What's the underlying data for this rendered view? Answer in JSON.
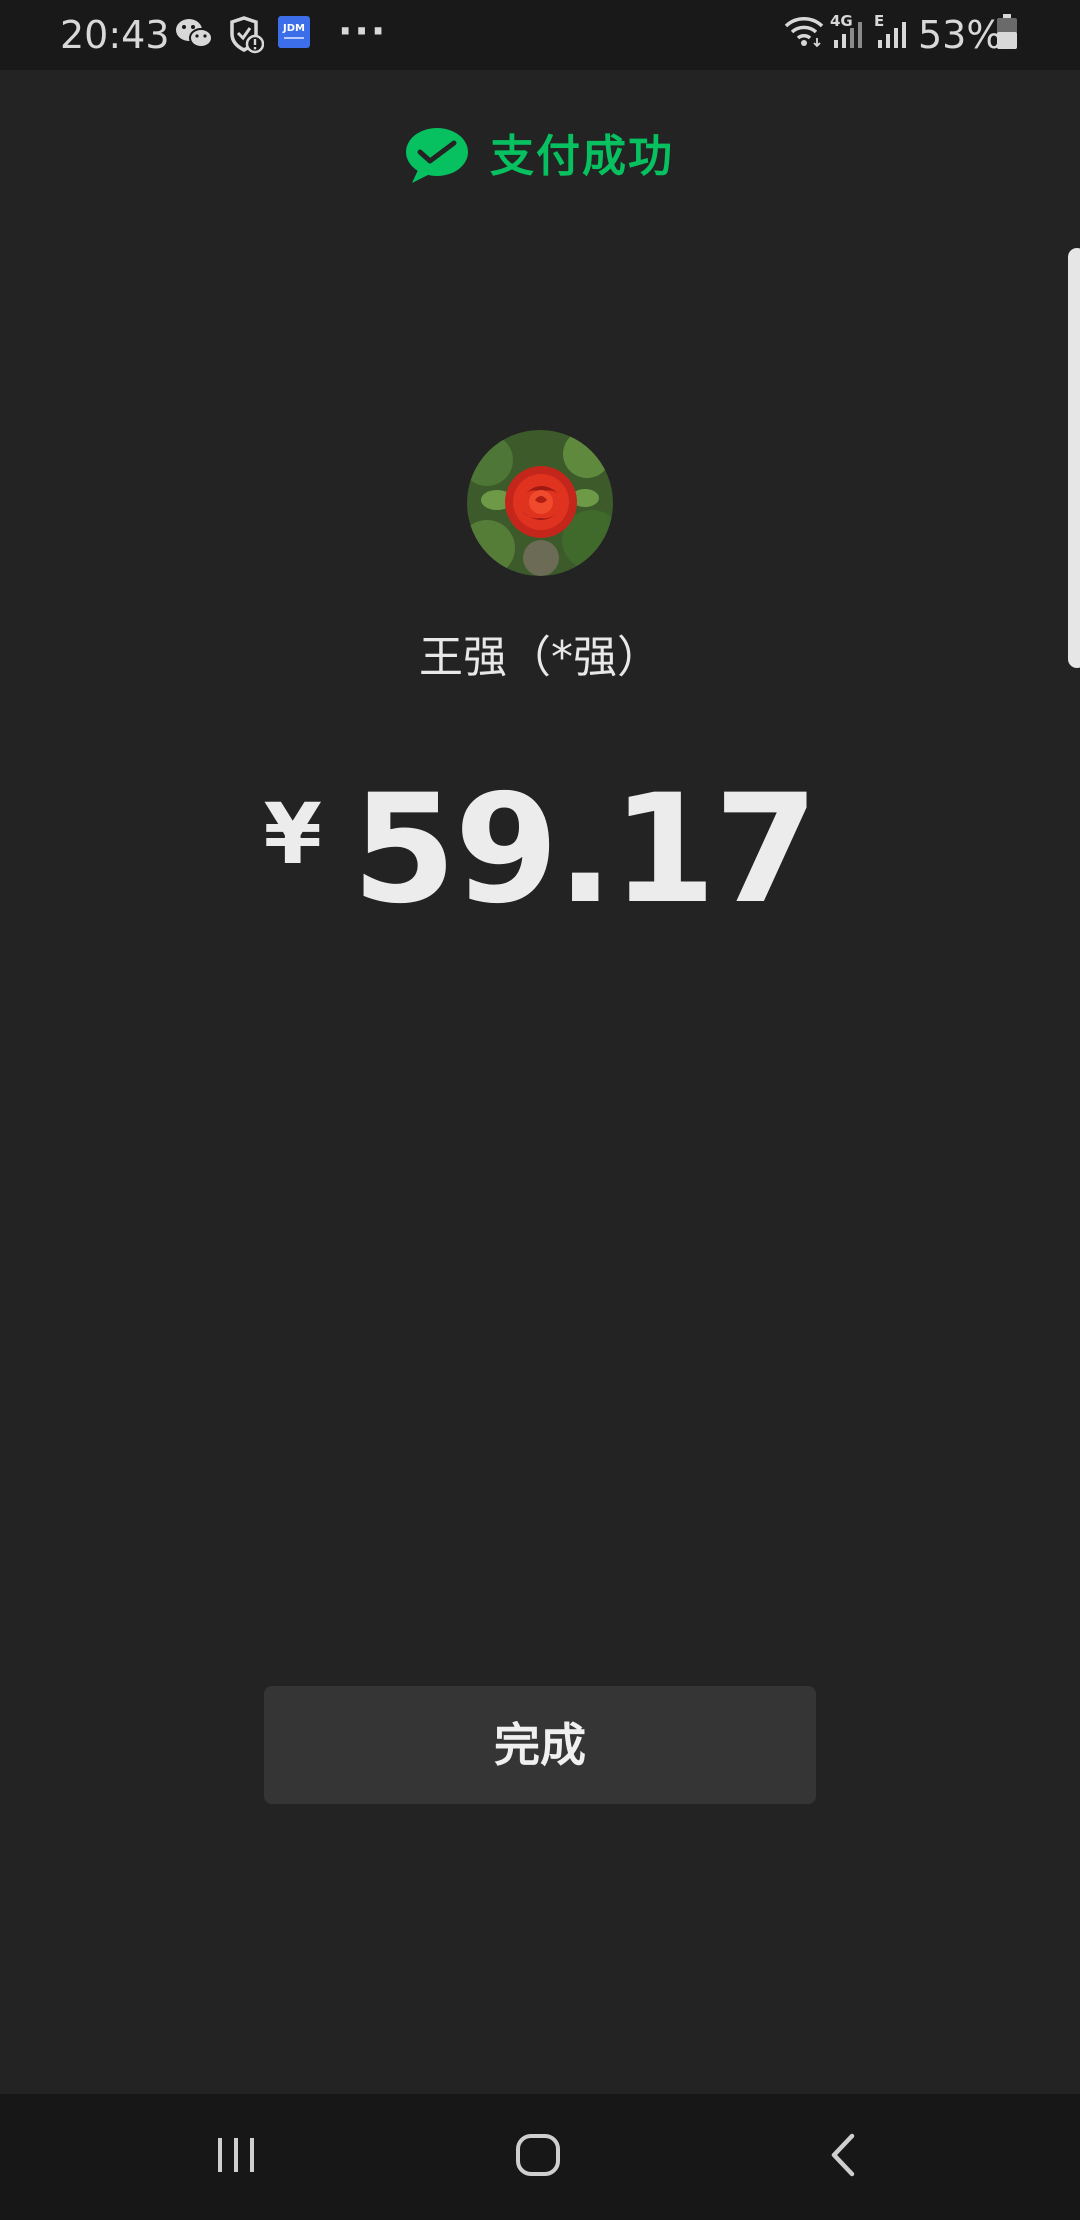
{
  "status_bar": {
    "time": "20:43",
    "more": "···",
    "network_4g": "4G",
    "network_e": "E",
    "battery": "53%",
    "icons": [
      "wechat-icon",
      "shield-notification-icon",
      "jdm-app-icon",
      "wifi-icon",
      "signal-icon",
      "battery-icon"
    ]
  },
  "header": {
    "title": "支付成功",
    "icon": "wechat-pay-icon"
  },
  "payee": {
    "avatar": "rose-avatar",
    "name": "王强（*强）"
  },
  "payment": {
    "currency": "¥",
    "amount": "59.17"
  },
  "actions": {
    "done_label": "完成"
  },
  "nav": {
    "icons": [
      "recents-icon",
      "home-icon",
      "back-icon"
    ]
  },
  "colors": {
    "background": "#232323",
    "accent_green": "#07c160",
    "button_bg": "#353535"
  }
}
